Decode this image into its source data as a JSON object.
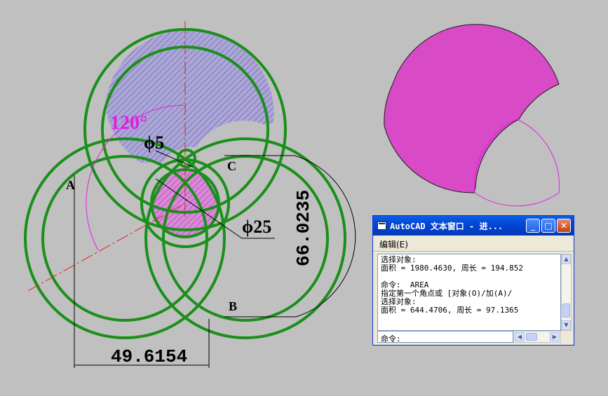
{
  "drawing": {
    "angle_label": "120°",
    "small_dia_label": "ϕ5",
    "large_dia_label": "ϕ25",
    "vertical_dim_label": "66.0235",
    "horizontal_dim_label": "49.6154",
    "point_a": "A",
    "point_b": "B",
    "point_c": "C",
    "colors": {
      "background": "#c0c0c0",
      "outline": "#1a8f1a",
      "hatch_fill": "#9c9cd0",
      "hatch_line": "#8c2a8c",
      "magenta": "#e020e0",
      "shape_fill": "#d84ac6",
      "centerline": "#e02020"
    }
  },
  "text_window": {
    "title": "AutoCAD 文本窗口 - 进...",
    "menu_edit": "编辑(E)",
    "history": [
      "选择对象:",
      "面积 = 1980.4630, 周长 = 194.852",
      "",
      "命令:  AREA",
      "指定第一个角点或 [对象(O)/加(A)/",
      "选择对象:",
      "面积 = 644.4706, 周长 = 97.1365"
    ],
    "command_prompt": "命令:",
    "buttons": {
      "minimize": "_",
      "maximize": "□",
      "close": "✕"
    }
  }
}
